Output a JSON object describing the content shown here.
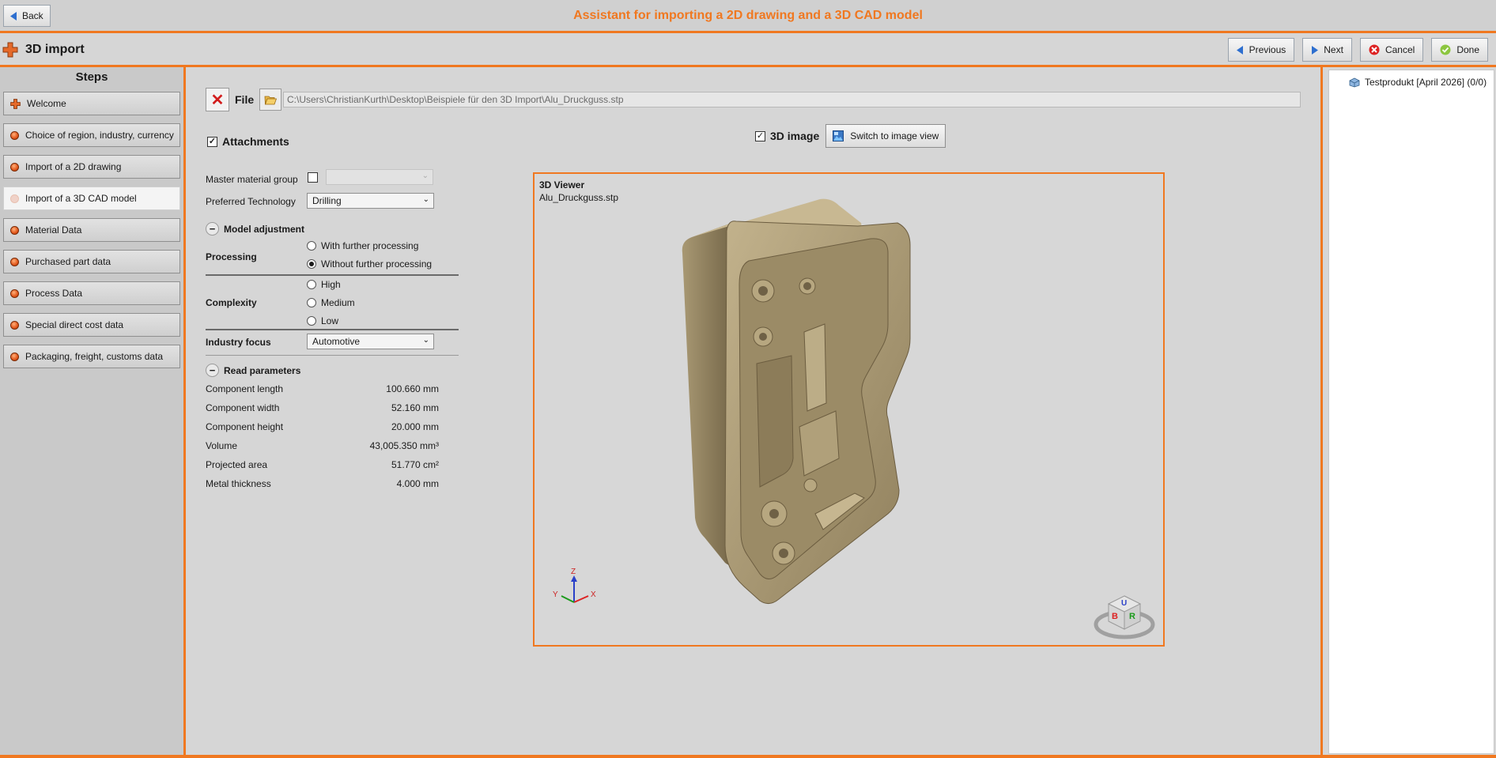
{
  "header": {
    "back_label": "Back",
    "app_title": "Assistant for importing a 2D drawing and a 3D CAD model"
  },
  "subheader": {
    "title": "3D import",
    "buttons": {
      "previous": "Previous",
      "next": "Next",
      "cancel": "Cancel",
      "done": "Done"
    }
  },
  "steps": {
    "title": "Steps",
    "items": [
      {
        "label": "Welcome",
        "icon": "plus-icon"
      },
      {
        "label": "Choice of region, industry, currency",
        "icon": "orange-dot-icon"
      },
      {
        "label": "Import of a 2D drawing",
        "icon": "orange-dot-icon"
      },
      {
        "label": "Import of a 3D CAD model",
        "icon": "pale-dot-icon",
        "active": true
      },
      {
        "label": "Material Data",
        "icon": "orange-dot-icon"
      },
      {
        "label": "Purchased part data",
        "icon": "orange-dot-icon"
      },
      {
        "label": "Process Data",
        "icon": "orange-dot-icon"
      },
      {
        "label": "Special direct cost data",
        "icon": "orange-dot-icon"
      },
      {
        "label": "Packaging, freight, customs data",
        "icon": "orange-dot-icon"
      }
    ]
  },
  "file": {
    "label": "File",
    "path": "C:\\Users\\ChristianKurth\\Desktop\\Beispiele für den 3D Import\\Alu_Druckguss.stp"
  },
  "attachments": {
    "label": "Attachments",
    "checked": true
  },
  "image3d": {
    "label": "3D image",
    "checked": true,
    "switch_label": "Switch to image view"
  },
  "form": {
    "master_material_group_label": "Master material group",
    "master_material_group_value": "",
    "preferred_technology_label": "Preferred Technology",
    "preferred_technology_value": "Drilling",
    "model_adjustment_label": "Model adjustment",
    "processing_label": "Processing",
    "processing_options": [
      "With further processing",
      "Without further processing"
    ],
    "processing_selected": "Without further processing",
    "complexity_label": "Complexity",
    "complexity_options": [
      "High",
      "Medium",
      "Low"
    ],
    "complexity_selected": "",
    "industry_focus_label": "Industry focus",
    "industry_focus_value": "Automotive",
    "read_parameters_label": "Read parameters"
  },
  "parameters": [
    {
      "label": "Component length",
      "value": "100.660 mm"
    },
    {
      "label": "Component width",
      "value": "52.160 mm"
    },
    {
      "label": "Component height",
      "value": "20.000 mm"
    },
    {
      "label": "Volume",
      "value": "43,005.350 mm³"
    },
    {
      "label": "Projected area",
      "value": "51.770 cm²"
    },
    {
      "label": "Metal thickness",
      "value": "4.000 mm"
    }
  ],
  "viewer": {
    "title": "3D Viewer",
    "filename": "Alu_Druckguss.stp",
    "axes": {
      "x": "X",
      "y": "Y",
      "z": "Z"
    },
    "cube_faces": {
      "top": "U",
      "left": "B",
      "right": "R"
    }
  },
  "tree": {
    "item_label": "Testprodukt [April 2026] (0/0)"
  },
  "colors": {
    "accent": "#f07820",
    "model": "#b5a582"
  }
}
